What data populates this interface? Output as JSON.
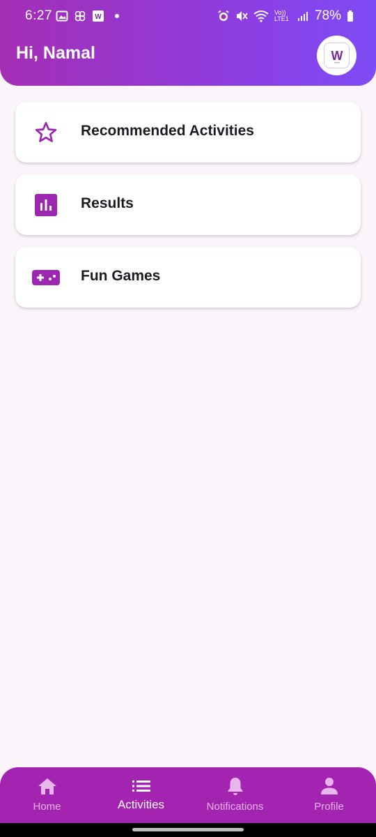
{
  "status_bar": {
    "time": "6:27",
    "battery": "78%",
    "network": "Vo)) LTE1"
  },
  "header": {
    "greeting": "Hi, Namal",
    "logo_letter": "W"
  },
  "menu": {
    "items": [
      {
        "label": "Recommended Activities",
        "icon": "star-outline-icon"
      },
      {
        "label": "Results",
        "icon": "bar-chart-icon"
      },
      {
        "label": "Fun Games",
        "icon": "gamepad-icon"
      }
    ]
  },
  "bottom_nav": {
    "items": [
      {
        "label": "Home",
        "icon": "home-icon",
        "active": false
      },
      {
        "label": "Activities",
        "icon": "list-icon",
        "active": true
      },
      {
        "label": "Notifications",
        "icon": "bell-icon",
        "active": false
      },
      {
        "label": "Profile",
        "icon": "person-icon",
        "active": false
      }
    ]
  },
  "colors": {
    "primary": "#9c27b0",
    "header_gradient_start": "#a42eb4",
    "header_gradient_end": "#7d4cf4",
    "background": "#fcf4fb",
    "nav_background": "#a424b2"
  }
}
